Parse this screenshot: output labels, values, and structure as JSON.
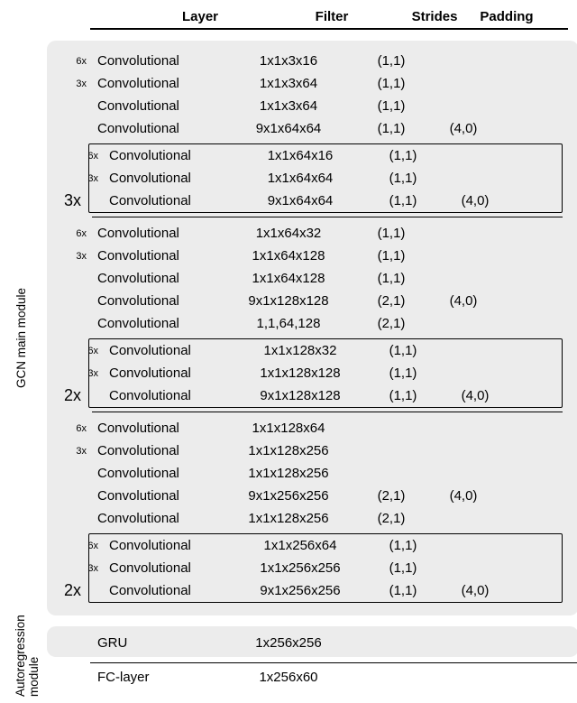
{
  "headers": {
    "layer": "Layer",
    "filter": "Filter",
    "strides": "Strides",
    "padding": "Padding"
  },
  "side_labels": {
    "gcn": "GCN main module",
    "ar": "Autoregression\nmodule"
  },
  "chart_data": {
    "type": "table",
    "title": "",
    "gcn_blocks": [
      {
        "multiplier": "3x",
        "top_rows": [
          {
            "rep": "6x",
            "layer": "Convolutional",
            "filter": "1x1x3x16",
            "strides": "(1,1)",
            "padding": ""
          },
          {
            "rep": "3x",
            "layer": "Convolutional",
            "filter": "1x1x3x64",
            "strides": "(1,1)",
            "padding": ""
          },
          {
            "rep": "",
            "layer": "Convolutional",
            "filter": "1x1x3x64",
            "strides": "(1,1)",
            "padding": ""
          },
          {
            "rep": "",
            "layer": "Convolutional",
            "filter": "9x1x64x64",
            "strides": "(1,1)",
            "padding": "(4,0)"
          }
        ],
        "boxed_rows": [
          {
            "rep": "6x",
            "layer": "Convolutional",
            "filter": "1x1x64x16",
            "strides": "(1,1)",
            "padding": ""
          },
          {
            "rep": "3x",
            "layer": "Convolutional",
            "filter": "1x1x64x64",
            "strides": "(1,1)",
            "padding": ""
          },
          {
            "rep": "",
            "layer": "Convolutional",
            "filter": "9x1x64x64",
            "strides": "(1,1)",
            "padding": "(4,0)"
          }
        ]
      },
      {
        "multiplier": "2x",
        "top_rows": [
          {
            "rep": "6x",
            "layer": "Convolutional",
            "filter": "1x1x64x32",
            "strides": "(1,1)",
            "padding": ""
          },
          {
            "rep": "3x",
            "layer": "Convolutional",
            "filter": "1x1x64x128",
            "strides": "(1,1)",
            "padding": ""
          },
          {
            "rep": "",
            "layer": "Convolutional",
            "filter": "1x1x64x128",
            "strides": "(1,1)",
            "padding": ""
          },
          {
            "rep": "",
            "layer": "Convolutional",
            "filter": "9x1x128x128",
            "strides": "(2,1)",
            "padding": "(4,0)"
          },
          {
            "rep": "",
            "layer": "Convolutional",
            "filter": "1,1,64,128",
            "strides": "(2,1)",
            "padding": ""
          }
        ],
        "boxed_rows": [
          {
            "rep": "6x",
            "layer": "Convolutional",
            "filter": "1x1x128x32",
            "strides": "(1,1)",
            "padding": ""
          },
          {
            "rep": "3x",
            "layer": "Convolutional",
            "filter": "1x1x128x128",
            "strides": "(1,1)",
            "padding": ""
          },
          {
            "rep": "",
            "layer": "Convolutional",
            "filter": "9x1x128x128",
            "strides": "(1,1)",
            "padding": "(4,0)"
          }
        ]
      },
      {
        "multiplier": "2x",
        "top_rows": [
          {
            "rep": "6x",
            "layer": "Convolutional",
            "filter": "1x1x128x64",
            "strides": "",
            "padding": ""
          },
          {
            "rep": "3x",
            "layer": "Convolutional",
            "filter": "1x1x128x256",
            "strides": "",
            "padding": ""
          },
          {
            "rep": "",
            "layer": "Convolutional",
            "filter": "1x1x128x256",
            "strides": "",
            "padding": ""
          },
          {
            "rep": "",
            "layer": "Convolutional",
            "filter": "9x1x256x256",
            "strides": "(2,1)",
            "padding": "(4,0)"
          },
          {
            "rep": "",
            "layer": "Convolutional",
            "filter": "1x1x128x256",
            "strides": "(2,1)",
            "padding": ""
          }
        ],
        "boxed_rows": [
          {
            "rep": "6x",
            "layer": "Convolutional",
            "filter": "1x1x256x64",
            "strides": "(1,1)",
            "padding": ""
          },
          {
            "rep": "3x",
            "layer": "Convolutional",
            "filter": "1x1x256x256",
            "strides": "(1,1)",
            "padding": ""
          },
          {
            "rep": "",
            "layer": "Convolutional",
            "filter": "9x1x256x256",
            "strides": "(1,1)",
            "padding": "(4,0)"
          }
        ]
      }
    ],
    "ar_rows": [
      {
        "rep": "",
        "layer": "GRU",
        "filter": "1x256x256",
        "strides": "",
        "padding": ""
      }
    ],
    "fc_row": {
      "rep": "",
      "layer": "FC-layer",
      "filter": "1x256x60",
      "strides": "",
      "padding": ""
    }
  }
}
